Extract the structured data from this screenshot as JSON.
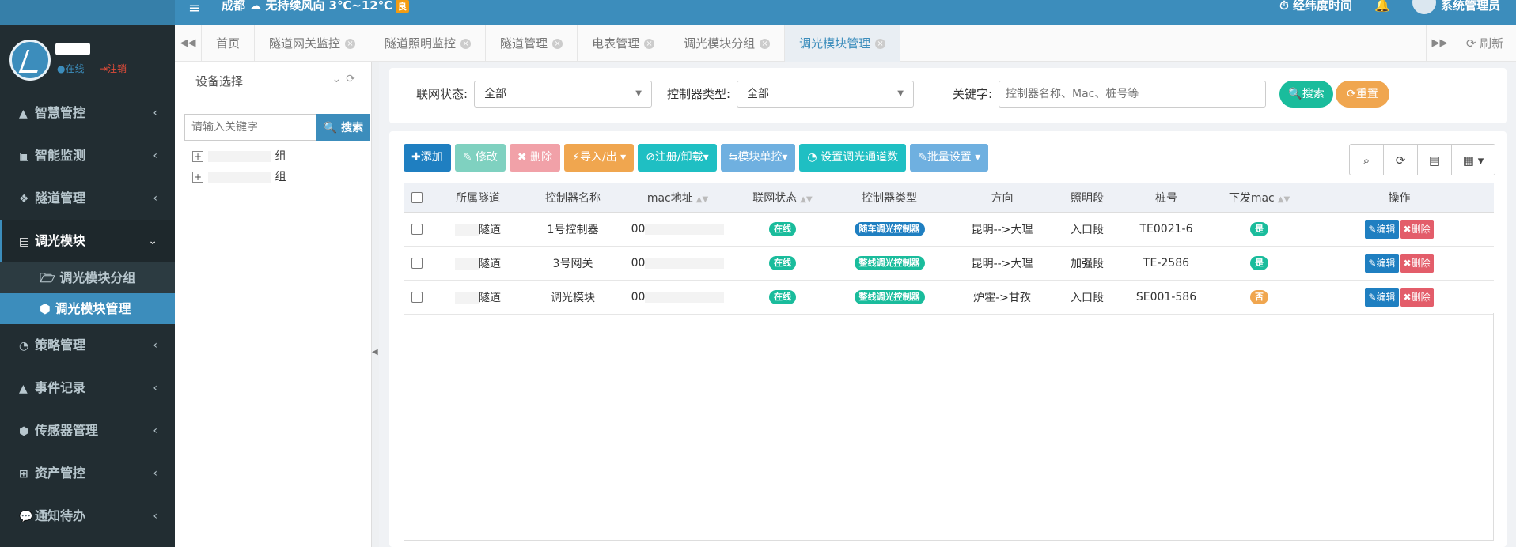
{
  "header": {
    "weather": "成都 ☁ 无持续风向 3℃~12℃",
    "aqi": "良",
    "menu_icon": "hamburger-icon",
    "right_items": [
      "经纬度时间",
      "系统管理员"
    ]
  },
  "sidebar": {
    "status_online": "●在线",
    "status_logout": "⇥注销",
    "items": [
      {
        "label": "智慧管控",
        "icon": "road-icon"
      },
      {
        "label": "智能监测",
        "icon": "monitor-icon"
      },
      {
        "label": "隧道管理",
        "icon": "cubes-icon"
      },
      {
        "label": "调光模块",
        "icon": "list-icon"
      },
      {
        "label": "策略管理",
        "icon": "dashboard-icon"
      },
      {
        "label": "事件记录",
        "icon": "road-icon"
      },
      {
        "label": "传感器管理",
        "icon": "cube-icon"
      },
      {
        "label": "资产管控",
        "icon": "gift-icon"
      },
      {
        "label": "通知待办",
        "icon": "comment-icon"
      }
    ],
    "submenu": [
      "调光模块分组",
      "调光模块管理"
    ]
  },
  "tabs": {
    "items": [
      "首页",
      "隧道网关监控",
      "隧道照明监控",
      "隧道管理",
      "电表管理",
      "调光模块分组",
      "调光模块管理"
    ],
    "refresh": "刷新"
  },
  "tree": {
    "title": "设备选择",
    "search_placeholder": "请输入关键字",
    "search_button": "搜索",
    "nodes": [
      "组",
      "组"
    ]
  },
  "filter": {
    "net_status_label": "联网状态:",
    "net_status_value": "全部",
    "controller_type_label": "控制器类型:",
    "controller_type_value": "全部",
    "keyword_label": "关键字:",
    "keyword_placeholder": "控制器名称、Mac、桩号等",
    "search_button": "搜索",
    "reset_button": "重置"
  },
  "toolbar": {
    "add": "添加",
    "edit": "修改",
    "delete": "删除",
    "import_export": "导入/出",
    "register": "注册/卸载",
    "module_control": "模块单控",
    "set_channels": "设置调光通道数",
    "batch": "批量设置"
  },
  "colors": {
    "primary": "#3c8dbc",
    "sidebar_bg": "#222d32",
    "green": "#1abc9c",
    "blue_dark": "#1f7fc1",
    "orange": "#f0a64f",
    "red": "#e35d6a"
  },
  "table": {
    "columns": [
      "所属隧道",
      "控制器名称",
      "mac地址",
      "联网状态",
      "控制器类型",
      "方向",
      "照明段",
      "桩号",
      "下发mac",
      "操作"
    ],
    "rows": [
      {
        "tunnel": "隧道",
        "name": "1号控制器",
        "mac": "00",
        "status": "在线",
        "type": "随车调光控制器",
        "dir": "昆明-->大理",
        "section": "入口段",
        "stake": "TE0021-6",
        "sent": "是"
      },
      {
        "tunnel": "隧道",
        "name": "3号网关",
        "mac": "00",
        "status": "在线",
        "type": "整线调光控制器",
        "dir": "昆明-->大理",
        "section": "加强段",
        "stake": "TE-2586",
        "sent": "是"
      },
      {
        "tunnel": "隧道",
        "name": "调光模块",
        "mac": "00",
        "status": "在线",
        "type": "整线调光控制器",
        "dir": "炉霍->甘孜",
        "section": "入口段",
        "stake": "SE001-586",
        "sent": "否"
      }
    ],
    "edit_label": "编辑",
    "delete_label": "删除"
  }
}
